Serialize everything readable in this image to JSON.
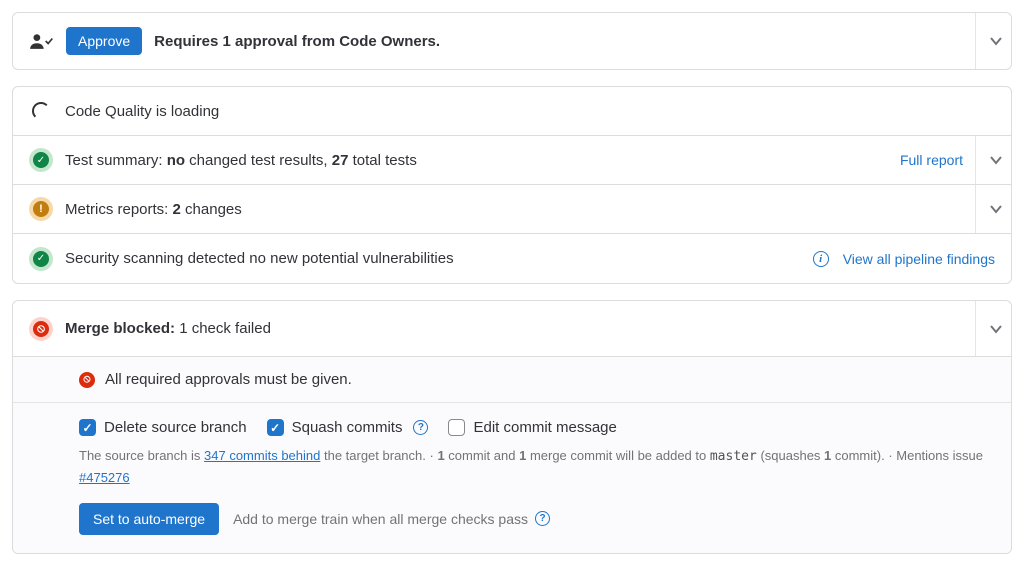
{
  "approval": {
    "approve_label": "Approve",
    "requires_prefix": "Requires ",
    "requires_count": "1",
    "requires_suffix": " approval from Code Owners."
  },
  "quality": {
    "loading_text": "Code Quality is loading"
  },
  "tests": {
    "label": "Test summary: ",
    "no": "no",
    "mid": " changed test results, ",
    "count": "27",
    "suffix": " total tests",
    "full_report": "Full report"
  },
  "metrics": {
    "label": "Metrics reports: ",
    "count": "2",
    "suffix": " changes"
  },
  "security": {
    "text": "Security scanning detected no new potential vulnerabilities",
    "view_all": "View all pipeline findings"
  },
  "merge": {
    "blocked_label": "Merge blocked:",
    "blocked_suffix": " 1 check failed",
    "approvals_required": "All required approvals must be given.",
    "delete_branch": "Delete source branch",
    "squash": "Squash commits",
    "edit_msg": "Edit commit message",
    "helper_prefix": "The source branch is ",
    "helper_link": "347 commits behind",
    "helper_mid": " the target branch. · ",
    "helper_bold1": "1",
    "helper_mid2": " commit and ",
    "helper_bold2": "1",
    "helper_mid3": " merge commit will be added to ",
    "helper_code": "master",
    "helper_mid4": " (squashes ",
    "helper_bold3": "1",
    "helper_end": " commit). · Mentions issue ",
    "issue_link": "#475276",
    "auto_merge_btn": "Set to auto-merge",
    "auto_merge_text": "Add to merge train when all merge checks pass"
  }
}
